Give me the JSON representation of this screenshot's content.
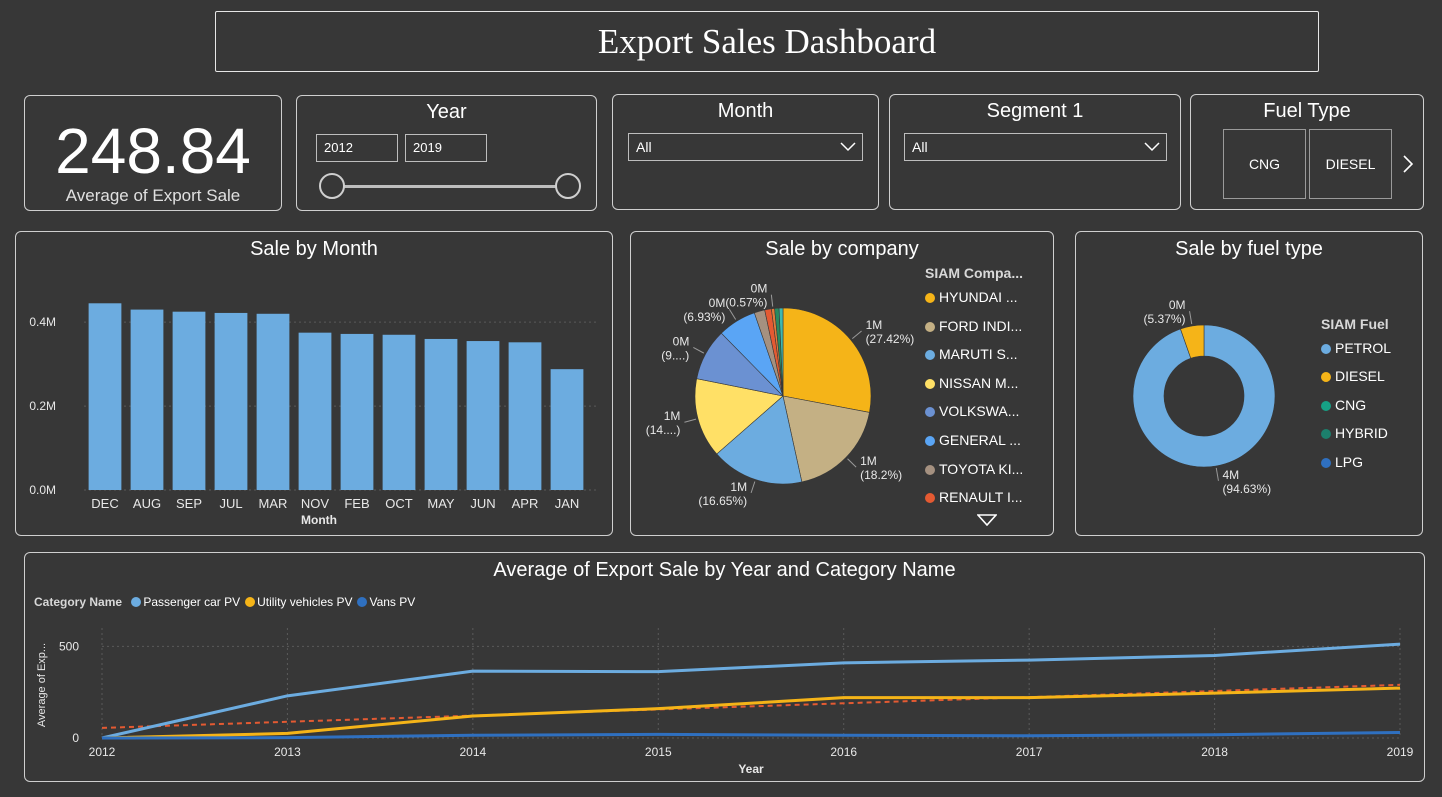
{
  "page": {
    "title": "Export Sales Dashboard"
  },
  "kpi": {
    "value": "248.84",
    "label": "Average of Export Sale"
  },
  "filters": {
    "year": {
      "title": "Year",
      "from": "2012",
      "to": "2019"
    },
    "month": {
      "title": "Month",
      "value": "All"
    },
    "segment": {
      "title": "Segment 1",
      "value": "All"
    },
    "fuel_type": {
      "title": "Fuel Type",
      "tiles": [
        "CNG",
        "DIESEL"
      ]
    }
  },
  "chart_data": [
    {
      "type": "bar",
      "title": "Sale by Month",
      "xlabel": "Month",
      "ylabel": "",
      "categories": [
        "DEC",
        "AUG",
        "SEP",
        "JUL",
        "MAR",
        "NOV",
        "FEB",
        "OCT",
        "MAY",
        "JUN",
        "APR",
        "JAN"
      ],
      "values": [
        0.445,
        0.43,
        0.425,
        0.422,
        0.42,
        0.375,
        0.372,
        0.37,
        0.36,
        0.355,
        0.352,
        0.288
      ],
      "ylim": [
        0,
        0.46
      ],
      "yticks": [
        0,
        0.2,
        0.4
      ],
      "ytick_labels": [
        "0.0M",
        "0.2M",
        "0.4M"
      ],
      "color": "#6cace0",
      "grid": true
    },
    {
      "type": "pie",
      "title": "Sale by company",
      "legend_title": "SIAM Compa...",
      "legend_items": [
        {
          "label": "HYUNDAI ...",
          "color": "#f5b418"
        },
        {
          "label": "FORD INDI...",
          "color": "#c4b084"
        },
        {
          "label": "MARUTI S...",
          "color": "#6cace0"
        },
        {
          "label": "NISSAN M...",
          "color": "#ffe066"
        },
        {
          "label": "VOLKSWA...",
          "color": "#6b91d2"
        },
        {
          "label": "GENERAL ...",
          "color": "#5aa5f5"
        },
        {
          "label": "TOYOTA KI...",
          "color": "#a59180"
        },
        {
          "label": "RENAULT I...",
          "color": "#e45a32"
        }
      ],
      "slices": [
        {
          "value": 27.42,
          "color": "#f5b418",
          "label": [
            "1M",
            "(27.42%)"
          ]
        },
        {
          "value": 18.2,
          "color": "#c4b084",
          "label": [
            "1M",
            "(18.2%)"
          ]
        },
        {
          "value": 16.65,
          "color": "#6cace0",
          "label": [
            "1M",
            "(16.65%)"
          ]
        },
        {
          "value": 14.3,
          "color": "#ffe066",
          "label": [
            "1M",
            "(14....)"
          ]
        },
        {
          "value": 9.3,
          "color": "#6b91d2",
          "label": [
            "0M",
            "(9....)"
          ]
        },
        {
          "value": 6.93,
          "color": "#5aa5f5",
          "label": [
            "0M",
            "(6.93%)"
          ]
        },
        {
          "value": 1.9,
          "color": "#a59180",
          "label": null
        },
        {
          "value": 1.2,
          "color": "#e45a32",
          "label": null
        },
        {
          "value": 0.57,
          "color": "#e07b3a",
          "label": [
            "0M",
            "(0.57%)"
          ]
        },
        {
          "value": 0.8,
          "color": "#2a8a60",
          "label": null
        },
        {
          "value": 0.7,
          "color": "#3fb8b0",
          "label": null
        }
      ]
    },
    {
      "type": "donut",
      "title": "Sale by fuel type",
      "legend_title": "SIAM Fuel",
      "legend_items": [
        {
          "label": "PETROL",
          "color": "#6cace0"
        },
        {
          "label": "DIESEL",
          "color": "#f5b418"
        },
        {
          "label": "CNG",
          "color": "#16a085"
        },
        {
          "label": "HYBRID",
          "color": "#1c7f6c"
        },
        {
          "label": "LPG",
          "color": "#2f70c0"
        }
      ],
      "slices": [
        {
          "value": 94.63,
          "color": "#6cace0",
          "label": [
            "4M",
            "(94.63%)"
          ]
        },
        {
          "value": 5.37,
          "color": "#f5b418",
          "label": [
            "0M",
            "(5.37%)"
          ]
        }
      ]
    },
    {
      "type": "line",
      "title": "Average of Export Sale by Year and Category Name",
      "legend_title": "Category Name",
      "xlabel": "Year",
      "ylabel": "Average of Exp...",
      "x": [
        2012,
        2013,
        2014,
        2015,
        2016,
        2017,
        2018,
        2019
      ],
      "ylim": [
        0,
        600
      ],
      "yticks": [
        0,
        500
      ],
      "series": [
        {
          "name": "Passenger car PV",
          "color": "#6cace0",
          "values": [
            0,
            230,
            365,
            362,
            410,
            425,
            450,
            512
          ]
        },
        {
          "name": "Utility vehicles PV",
          "color": "#f5b418",
          "values": [
            0,
            25,
            120,
            160,
            220,
            220,
            245,
            272
          ]
        },
        {
          "name": "Vans PV",
          "color": "#2f70c0",
          "values": [
            0,
            2,
            15,
            20,
            15,
            12,
            18,
            30
          ]
        }
      ],
      "trend": {
        "color": "#e45a32",
        "start": 55,
        "end": 290
      },
      "grid": true
    }
  ]
}
